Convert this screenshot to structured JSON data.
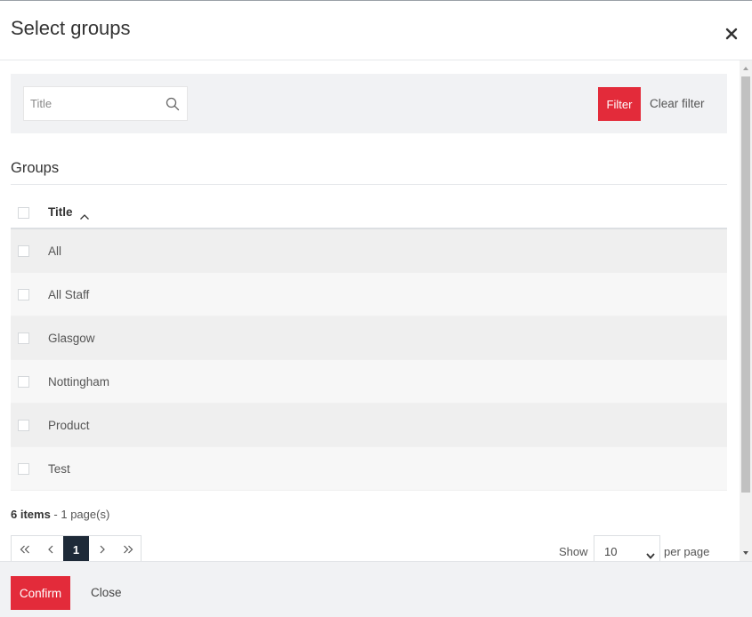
{
  "modal": {
    "title": "Select groups",
    "close_icon": "close-icon"
  },
  "filter": {
    "search_placeholder": "Title",
    "filter_label": "Filter",
    "clear_label": "Clear filter"
  },
  "section": {
    "title": "Groups"
  },
  "table": {
    "header": {
      "title": "Title"
    },
    "rows": [
      "All",
      "All Staff",
      "Glasgow",
      "Nottingham",
      "Product",
      "Test"
    ]
  },
  "summary": {
    "items": "6 items",
    "pages": " - 1 page(s)"
  },
  "pagination": {
    "first": "«",
    "prev": "‹",
    "current": "1",
    "next": "›",
    "last": "»"
  },
  "page_size": {
    "show": "Show",
    "value": "10",
    "per_page": "per page"
  },
  "footer": {
    "confirm_label": "Confirm",
    "close_label": "Close"
  },
  "colors": {
    "accent": "#e32b3a",
    "pager_active": "#1e2a38"
  }
}
